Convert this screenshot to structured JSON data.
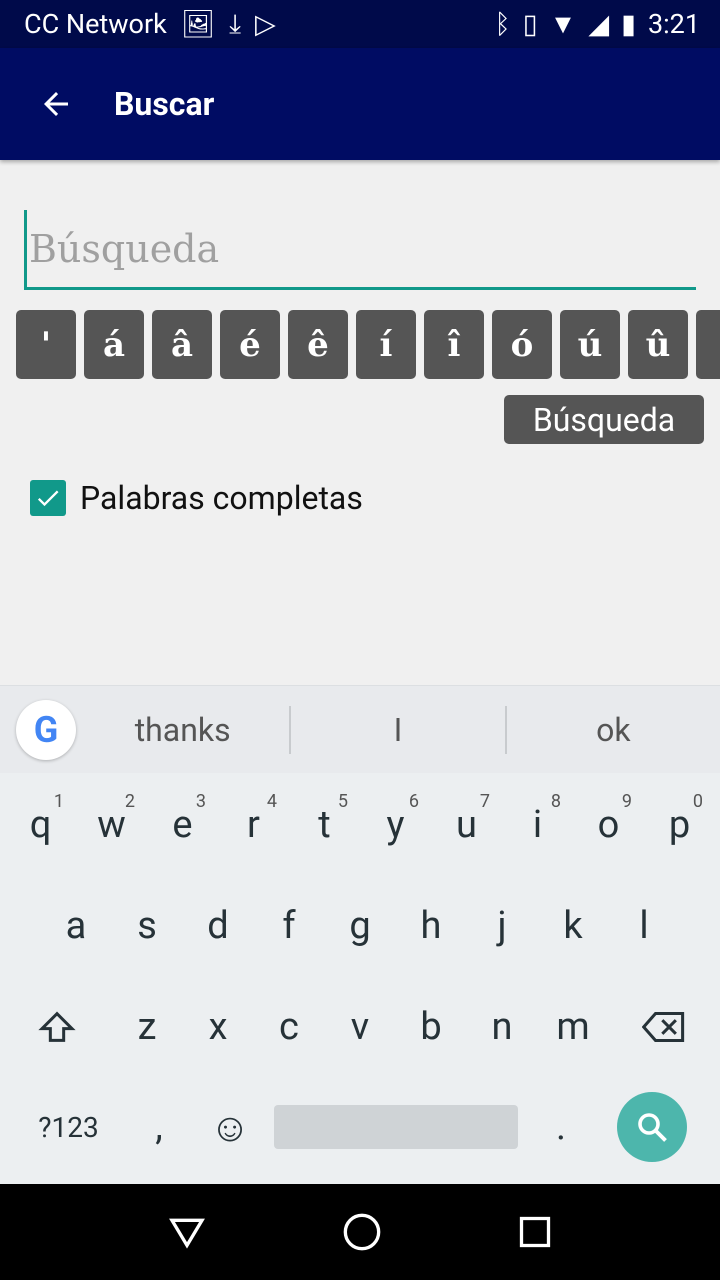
{
  "status": {
    "carrier": "CC Network",
    "time": "3:21"
  },
  "appbar": {
    "title": "Buscar"
  },
  "search": {
    "placeholder": "Búsqueda",
    "value": ""
  },
  "char_keys": [
    "'",
    "á",
    "â",
    "é",
    "ê",
    "í",
    "î",
    "ó",
    "ú",
    "û",
    ""
  ],
  "search_button": "Búsqueda",
  "checkbox": {
    "label": "Palabras completas",
    "checked": true
  },
  "accent": "#11998a",
  "keyboard": {
    "suggestions": [
      "thanks",
      "I",
      "ok"
    ],
    "row1": [
      [
        "q",
        "1"
      ],
      [
        "w",
        "2"
      ],
      [
        "e",
        "3"
      ],
      [
        "r",
        "4"
      ],
      [
        "t",
        "5"
      ],
      [
        "y",
        "6"
      ],
      [
        "u",
        "7"
      ],
      [
        "i",
        "8"
      ],
      [
        "o",
        "9"
      ],
      [
        "p",
        "0"
      ]
    ],
    "row2": [
      "a",
      "s",
      "d",
      "f",
      "g",
      "h",
      "j",
      "k",
      "l"
    ],
    "row3": [
      "z",
      "x",
      "c",
      "v",
      "b",
      "n",
      "m"
    ],
    "symbols": "?123",
    "comma": ",",
    "period": "."
  }
}
